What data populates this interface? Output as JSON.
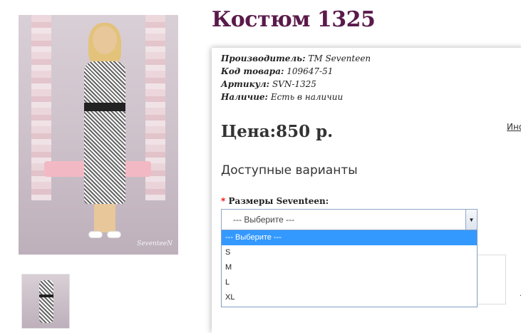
{
  "product": {
    "title": "Костюм 1325",
    "photo_watermark": "SeventeeN",
    "info": [
      {
        "label": "Производитель:",
        "value": "TM Seventeen"
      },
      {
        "label": "Код товара:",
        "value": "109647-51"
      },
      {
        "label": "Артикул:",
        "value": "SVN-1325"
      },
      {
        "label": "Наличие:",
        "value": "Есть в наличии"
      }
    ],
    "price": "Цена:850 р.",
    "side_link": "Ино"
  },
  "options": {
    "title": "Доступные варианты",
    "required_mark": "*",
    "size_label": "Размеры Seventeen:",
    "select_value": "--- Выберите ---",
    "dropdown": [
      {
        "label": "--- Выберите ---",
        "selected": true
      },
      {
        "label": "S",
        "selected": false
      },
      {
        "label": "M",
        "selected": false
      },
      {
        "label": "L",
        "selected": false
      },
      {
        "label": "XL",
        "selected": false
      }
    ]
  },
  "colors": {
    "title": "#5a1a4a",
    "selected_option": "#3399ff",
    "required": "#e00000"
  },
  "icons": {
    "select_arrow": "chevron-down-icon"
  }
}
